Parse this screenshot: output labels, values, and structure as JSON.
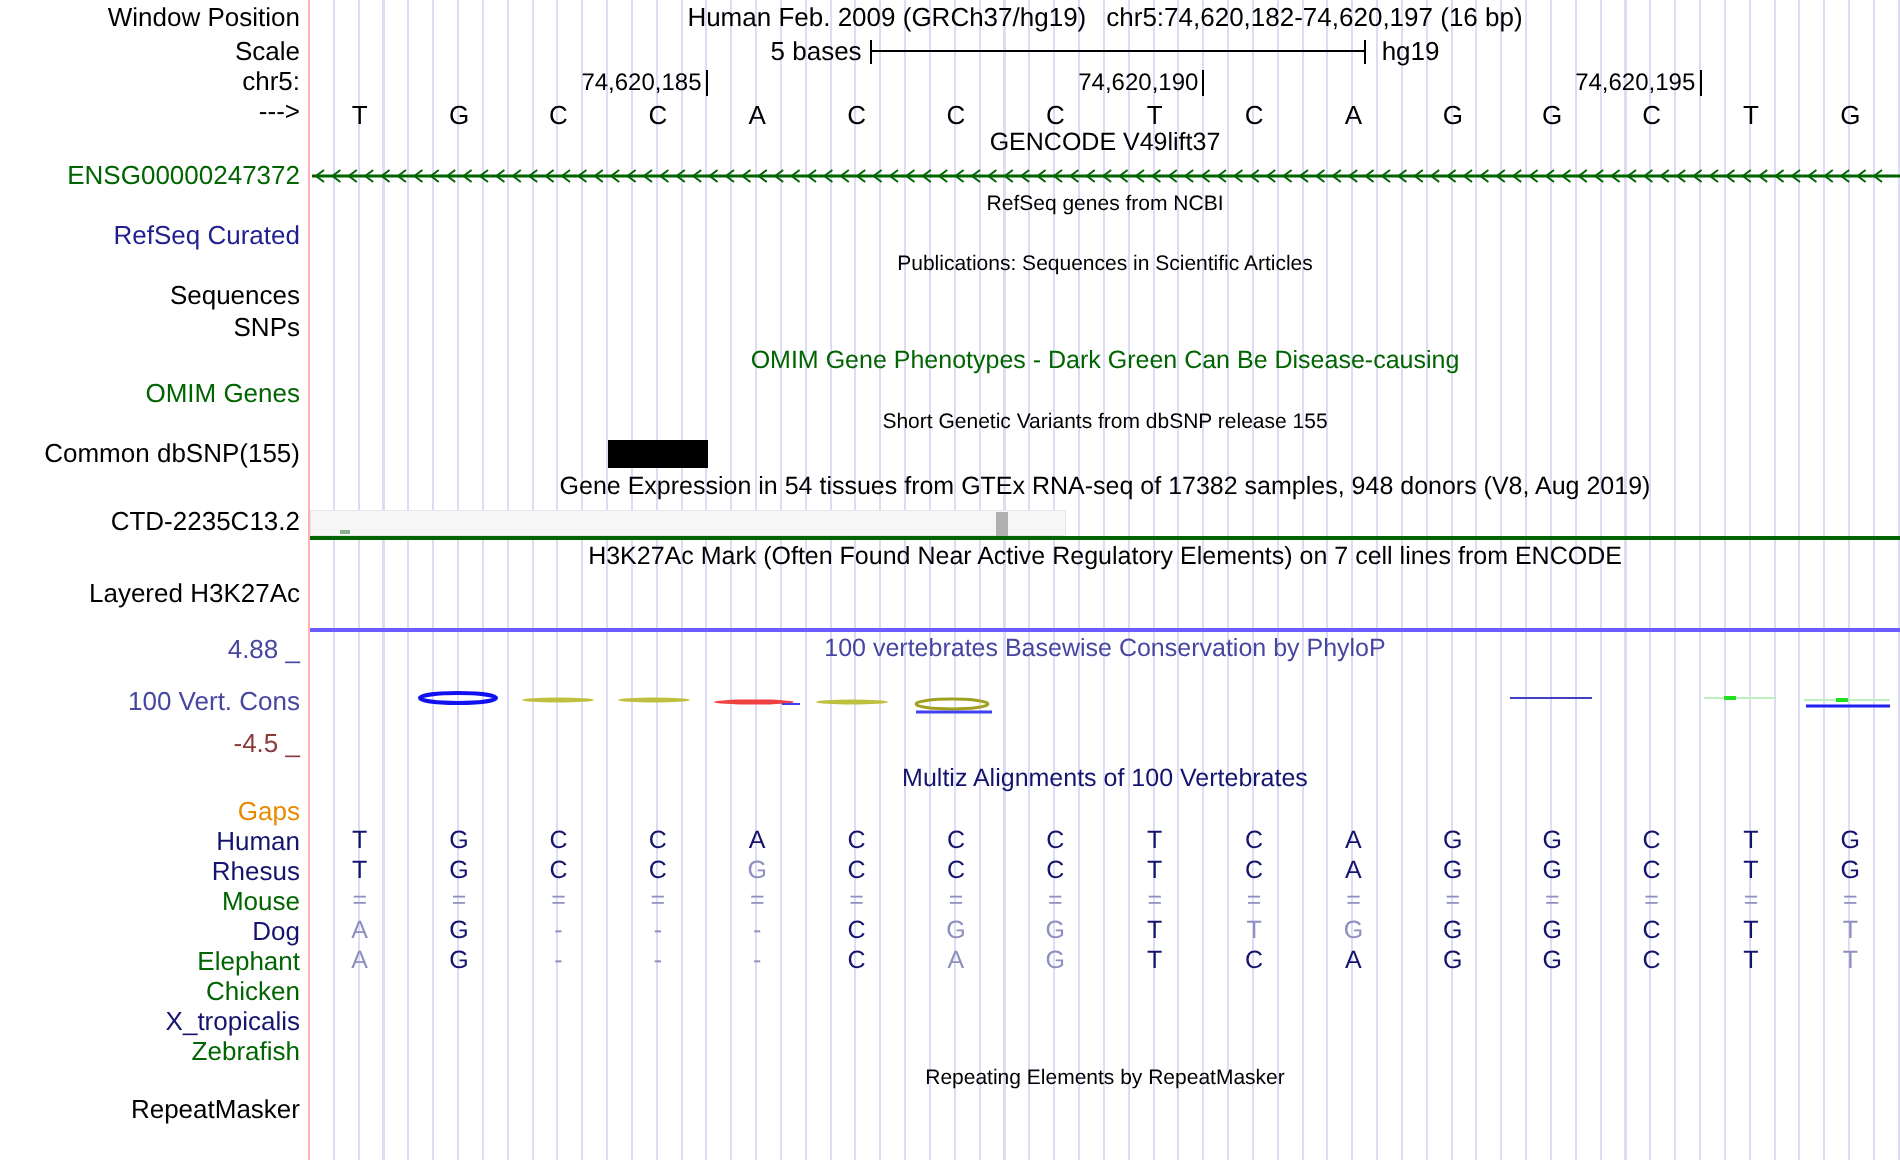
{
  "header": {
    "position_label": "Window Position",
    "assembly_title": "Human Feb. 2009 (GRCh37/hg19)",
    "position": "chr5:74,620,182-74,620,197 (16 bp)",
    "scale_label": "Scale",
    "scale_text": "5 bases",
    "scale_assembly": "hg19",
    "chrom_label": "chr5:",
    "ticks": [
      "74,620,185",
      "74,620,190",
      "74,620,195"
    ],
    "strand_label": "--->",
    "bases": [
      "T",
      "G",
      "C",
      "C",
      "A",
      "C",
      "C",
      "C",
      "T",
      "C",
      "A",
      "G",
      "G",
      "C",
      "T",
      "G"
    ]
  },
  "tracks": [
    {
      "title": "GENCODE V49lift37",
      "color": "#000000",
      "compact": false,
      "rows": [
        {
          "kind": "gene",
          "label": "ENSG00000247372",
          "color": "#006400"
        }
      ]
    },
    {
      "title": "RefSeq genes from NCBI",
      "color": "#000000",
      "compact": true,
      "rows": [
        {
          "kind": "empty",
          "label": "RefSeq Curated",
          "color": "#1f1f8f"
        }
      ]
    },
    {
      "title": "Publications: Sequences in Scientific Articles",
      "color": "#000000",
      "compact": true,
      "rows": [
        {
          "kind": "empty",
          "label": "Sequences",
          "color": "#000000"
        },
        {
          "kind": "empty",
          "label": "SNPs",
          "color": "#000000"
        }
      ]
    },
    {
      "title": "OMIM Gene Phenotypes - Dark Green Can Be Disease-causing",
      "color": "#006400",
      "compact": false,
      "rows": [
        {
          "kind": "empty",
          "label": "OMIM Genes",
          "color": "#006400"
        }
      ]
    },
    {
      "title": "Short Genetic Variants from dbSNP release 155",
      "color": "#000000",
      "compact": true,
      "rows": [
        {
          "kind": "snp",
          "label": "Common dbSNP(155)",
          "color": "#000000"
        }
      ]
    },
    {
      "title": "Gene Expression in 54 tissues from GTEx RNA-seq of 17382 samples, 948 donors (V8, Aug 2019)",
      "color": "#000000",
      "compact": false,
      "rows": [
        {
          "kind": "expression",
          "label": "CTD-2235C13.2",
          "color": "#000000"
        }
      ]
    },
    {
      "title": "H3K27Ac Mark (Often Found Near Active Regulatory Elements) on 7 cell lines from ENCODE",
      "color": "#000000",
      "compact": false,
      "rows": [
        {
          "kind": "layered",
          "label": "Layered H3K27Ac",
          "color": "#000000"
        }
      ]
    },
    {
      "title": "100 vertebrates Basewise Conservation by PhyloP",
      "color": "#4646a0",
      "compact": false,
      "scale_max": "4.88 _",
      "rows": [
        {
          "kind": "conservation",
          "label": "100 Vert. Cons",
          "color": "#4646a0",
          "scale_min": "-4.5 _"
        }
      ]
    },
    {
      "title": "Multiz Alignments of 100 Vertebrates",
      "color": "#14146e",
      "compact": false,
      "rows": [
        {
          "kind": "gaps",
          "label": "Gaps",
          "color": "#e68a00"
        },
        {
          "kind": "species",
          "label": "Human",
          "color": "#14146e",
          "bases": [
            {
              "b": "T",
              "match": true
            },
            {
              "b": "G",
              "match": true
            },
            {
              "b": "C",
              "match": true
            },
            {
              "b": "C",
              "match": true
            },
            {
              "b": "A",
              "match": true
            },
            {
              "b": "C",
              "match": true
            },
            {
              "b": "C",
              "match": true
            },
            {
              "b": "C",
              "match": true
            },
            {
              "b": "T",
              "match": true
            },
            {
              "b": "C",
              "match": true
            },
            {
              "b": "A",
              "match": true
            },
            {
              "b": "G",
              "match": true
            },
            {
              "b": "G",
              "match": true
            },
            {
              "b": "C",
              "match": true
            },
            {
              "b": "T",
              "match": true
            },
            {
              "b": "G",
              "match": true
            }
          ]
        },
        {
          "kind": "species",
          "label": "Rhesus",
          "color": "#14146e",
          "bases": [
            {
              "b": "T",
              "match": true
            },
            {
              "b": "G",
              "match": true
            },
            {
              "b": "C",
              "match": true
            },
            {
              "b": "C",
              "match": true
            },
            {
              "b": "G",
              "match": false
            },
            {
              "b": "C",
              "match": true
            },
            {
              "b": "C",
              "match": true
            },
            {
              "b": "C",
              "match": true
            },
            {
              "b": "T",
              "match": true
            },
            {
              "b": "C",
              "match": true
            },
            {
              "b": "A",
              "match": true
            },
            {
              "b": "G",
              "match": true
            },
            {
              "b": "G",
              "match": true
            },
            {
              "b": "C",
              "match": true
            },
            {
              "b": "T",
              "match": true
            },
            {
              "b": "G",
              "match": true
            }
          ]
        },
        {
          "kind": "species",
          "label": "Mouse",
          "color": "#006400",
          "bases": [
            {
              "b": "=",
              "match": false
            },
            {
              "b": "=",
              "match": false
            },
            {
              "b": "=",
              "match": false
            },
            {
              "b": "=",
              "match": false
            },
            {
              "b": "=",
              "match": false
            },
            {
              "b": "=",
              "match": false
            },
            {
              "b": "=",
              "match": false
            },
            {
              "b": "=",
              "match": false
            },
            {
              "b": "=",
              "match": false
            },
            {
              "b": "=",
              "match": false
            },
            {
              "b": "=",
              "match": false
            },
            {
              "b": "=",
              "match": false
            },
            {
              "b": "=",
              "match": false
            },
            {
              "b": "=",
              "match": false
            },
            {
              "b": "=",
              "match": false
            },
            {
              "b": "=",
              "match": false
            }
          ]
        },
        {
          "kind": "species",
          "label": "Dog",
          "color": "#14146e",
          "bases": [
            {
              "b": "A",
              "match": false
            },
            {
              "b": "G",
              "match": true
            },
            {
              "b": "-",
              "match": false
            },
            {
              "b": "-",
              "match": false
            },
            {
              "b": "-",
              "match": false
            },
            {
              "b": "C",
              "match": true
            },
            {
              "b": "G",
              "match": false
            },
            {
              "b": "G",
              "match": false
            },
            {
              "b": "T",
              "match": true
            },
            {
              "b": "T",
              "match": false
            },
            {
              "b": "G",
              "match": false
            },
            {
              "b": "G",
              "match": true
            },
            {
              "b": "G",
              "match": true
            },
            {
              "b": "C",
              "match": true
            },
            {
              "b": "T",
              "match": true
            },
            {
              "b": "T",
              "match": false
            }
          ]
        },
        {
          "kind": "species",
          "label": "Elephant",
          "color": "#006400",
          "bases": [
            {
              "b": "A",
              "match": false
            },
            {
              "b": "G",
              "match": true
            },
            {
              "b": "-",
              "match": false
            },
            {
              "b": "-",
              "match": false
            },
            {
              "b": "-",
              "match": false
            },
            {
              "b": "C",
              "match": true
            },
            {
              "b": "A",
              "match": false
            },
            {
              "b": "G",
              "match": false
            },
            {
              "b": "T",
              "match": true
            },
            {
              "b": "C",
              "match": true
            },
            {
              "b": "A",
              "match": true
            },
            {
              "b": "G",
              "match": true
            },
            {
              "b": "G",
              "match": true
            },
            {
              "b": "C",
              "match": true
            },
            {
              "b": "T",
              "match": true
            },
            {
              "b": "T",
              "match": false
            }
          ]
        },
        {
          "kind": "species",
          "label": "Chicken",
          "color": "#006400"
        },
        {
          "kind": "species",
          "label": "X_tropicalis",
          "color": "#14146e"
        },
        {
          "kind": "species",
          "label": "Zebrafish",
          "color": "#006400"
        }
      ]
    },
    {
      "title": "Repeating Elements by RepeatMasker",
      "color": "#000000",
      "compact": true,
      "rows": [
        {
          "kind": "empty",
          "label": "RepeatMasker",
          "color": "#000000"
        }
      ]
    }
  ]
}
